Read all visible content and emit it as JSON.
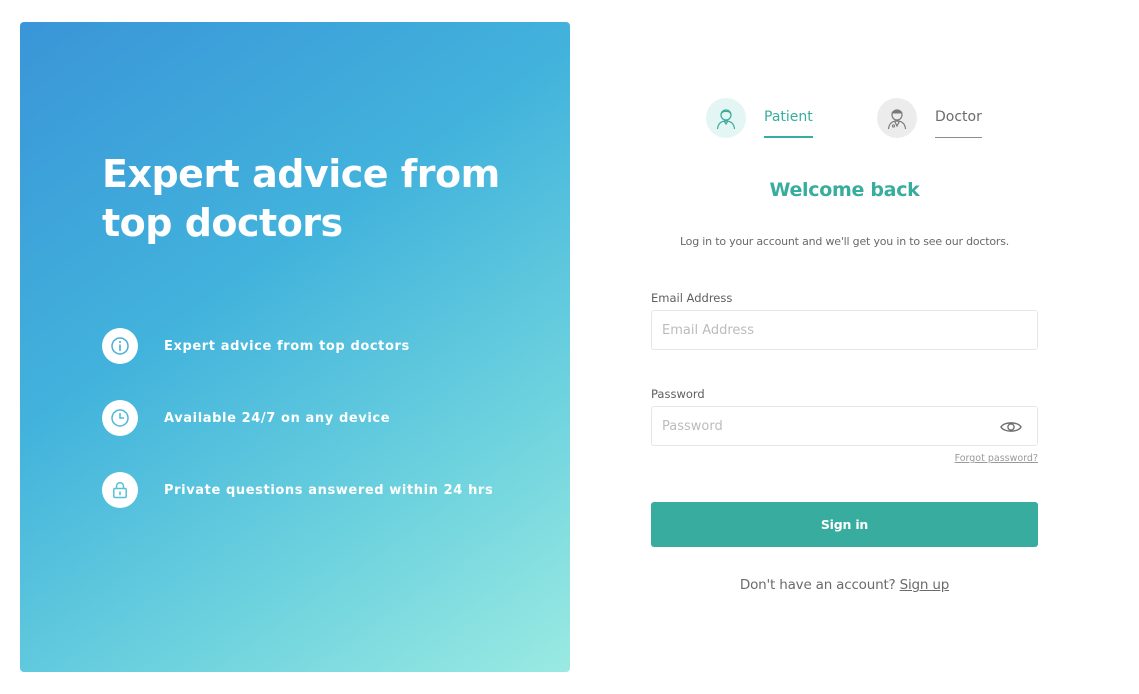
{
  "hero": {
    "title": "Expert advice from top doctors",
    "features": [
      {
        "icon": "info-icon",
        "text": "Expert advice from top doctors"
      },
      {
        "icon": "clock-icon",
        "text": "Available 24/7 on any device"
      },
      {
        "icon": "lock-icon",
        "text": "Private questions answered within 24 hrs"
      }
    ]
  },
  "roles": {
    "patient": {
      "label": "Patient",
      "icon": "patient-avatar-icon",
      "selected": true
    },
    "doctor": {
      "label": "Doctor",
      "icon": "doctor-avatar-icon",
      "selected": false
    }
  },
  "form": {
    "title": "Welcome back",
    "subtitle": "Log in to your account and we'll get you in to see our doctors.",
    "email": {
      "label": "Email Address",
      "placeholder": "Email Address",
      "value": ""
    },
    "password": {
      "label": "Password",
      "placeholder": "Password",
      "value": "",
      "toggle_icon": "eye-icon"
    },
    "forgot_label": "Forgot password?",
    "submit_label": "Sign in",
    "signup_prompt": "Don't have an account?",
    "signup_link": "Sign up"
  },
  "colors": {
    "accent": "#38ad9f",
    "hero_gradient": [
      "#3a95d8",
      "#42b3dc",
      "#6dd2de",
      "#9aeae2"
    ],
    "active_tab_underline": "#38ad9f",
    "inactive_tab_underline": "#8c8c8c"
  }
}
